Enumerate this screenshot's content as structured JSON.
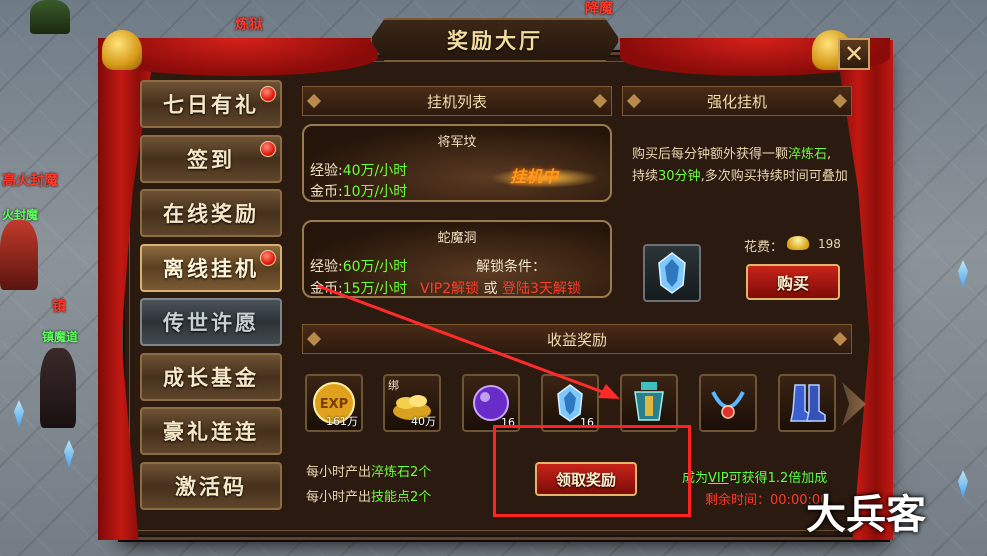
{
  "window": {
    "title": "奖励大厅",
    "close_glyph": "✕"
  },
  "background": {
    "labels": [
      "炼狱",
      "降魔",
      "高火封魔",
      "火封魔",
      "镇魔道",
      "镇"
    ]
  },
  "menu": {
    "items": [
      {
        "label": "七日有礼",
        "badge": true,
        "state": "normal"
      },
      {
        "label": "签到",
        "badge": true,
        "state": "normal"
      },
      {
        "label": "在线奖励",
        "badge": false,
        "state": "normal"
      },
      {
        "label": "离线挂机",
        "badge": true,
        "state": "active"
      },
      {
        "label": "传世许愿",
        "badge": false,
        "state": "dim"
      },
      {
        "label": "成长基金",
        "badge": false,
        "state": "normal"
      },
      {
        "label": "豪礼连连",
        "badge": false,
        "state": "normal"
      },
      {
        "label": "激活码",
        "badge": false,
        "state": "normal"
      }
    ]
  },
  "idle_list": {
    "header": "挂机列表",
    "cards": [
      {
        "title": "将军坟",
        "exp_label": "经验:",
        "exp_value": "40万/小时",
        "gold_label": "金币:",
        "gold_value": "10万/小时",
        "status": "挂机中"
      },
      {
        "title": "蛇魔洞",
        "exp_label": "经验:",
        "exp_value": "60万/小时",
        "gold_label": "金币:",
        "gold_value": "15万/小时",
        "unlock_label": "解锁条件：",
        "unlock_vip": "VIP2解锁",
        "unlock_or": "或",
        "unlock_login": "登陆3天解锁"
      }
    ]
  },
  "boost": {
    "header": "强化挂机",
    "desc_1": "购买后每分钟额外获得一颗",
    "desc_item": "淬炼石",
    "desc_2": ",",
    "desc_3": "持续",
    "desc_minutes": "30分钟",
    "desc_4": ",多次购买持续时间可叠加",
    "cost_label": "花费：",
    "cost_value": "198",
    "buy_label": "购买"
  },
  "rewards": {
    "header": "收益奖励",
    "items": [
      {
        "icon": "exp-orb-icon",
        "count": "161万"
      },
      {
        "icon": "gold-pile-icon",
        "tag": "绑",
        "count": "40万"
      },
      {
        "icon": "purple-orb-icon",
        "count": "16"
      },
      {
        "icon": "blue-stone-icon",
        "count": "16"
      },
      {
        "icon": "armor-icon",
        "count": ""
      },
      {
        "icon": "necklace-icon",
        "count": ""
      },
      {
        "icon": "boots-icon",
        "count": ""
      }
    ],
    "output_1_prefix": "每小时产出",
    "output_1_item": "淬炼石2个",
    "output_2_prefix": "每小时产出",
    "output_2_item": "技能点2个",
    "claim_label": "领取奖励",
    "vip_prefix": "成为",
    "vip_link": "VIP",
    "vip_suffix": "可获得1.2倍加成",
    "remain_label": "剩余时间：",
    "remain_value": "00:00:00"
  },
  "watermark": "大兵客",
  "colors": {
    "accent_red": "#ff2222",
    "green_text": "#6dff3c",
    "gold_text": "#f0dcae"
  }
}
